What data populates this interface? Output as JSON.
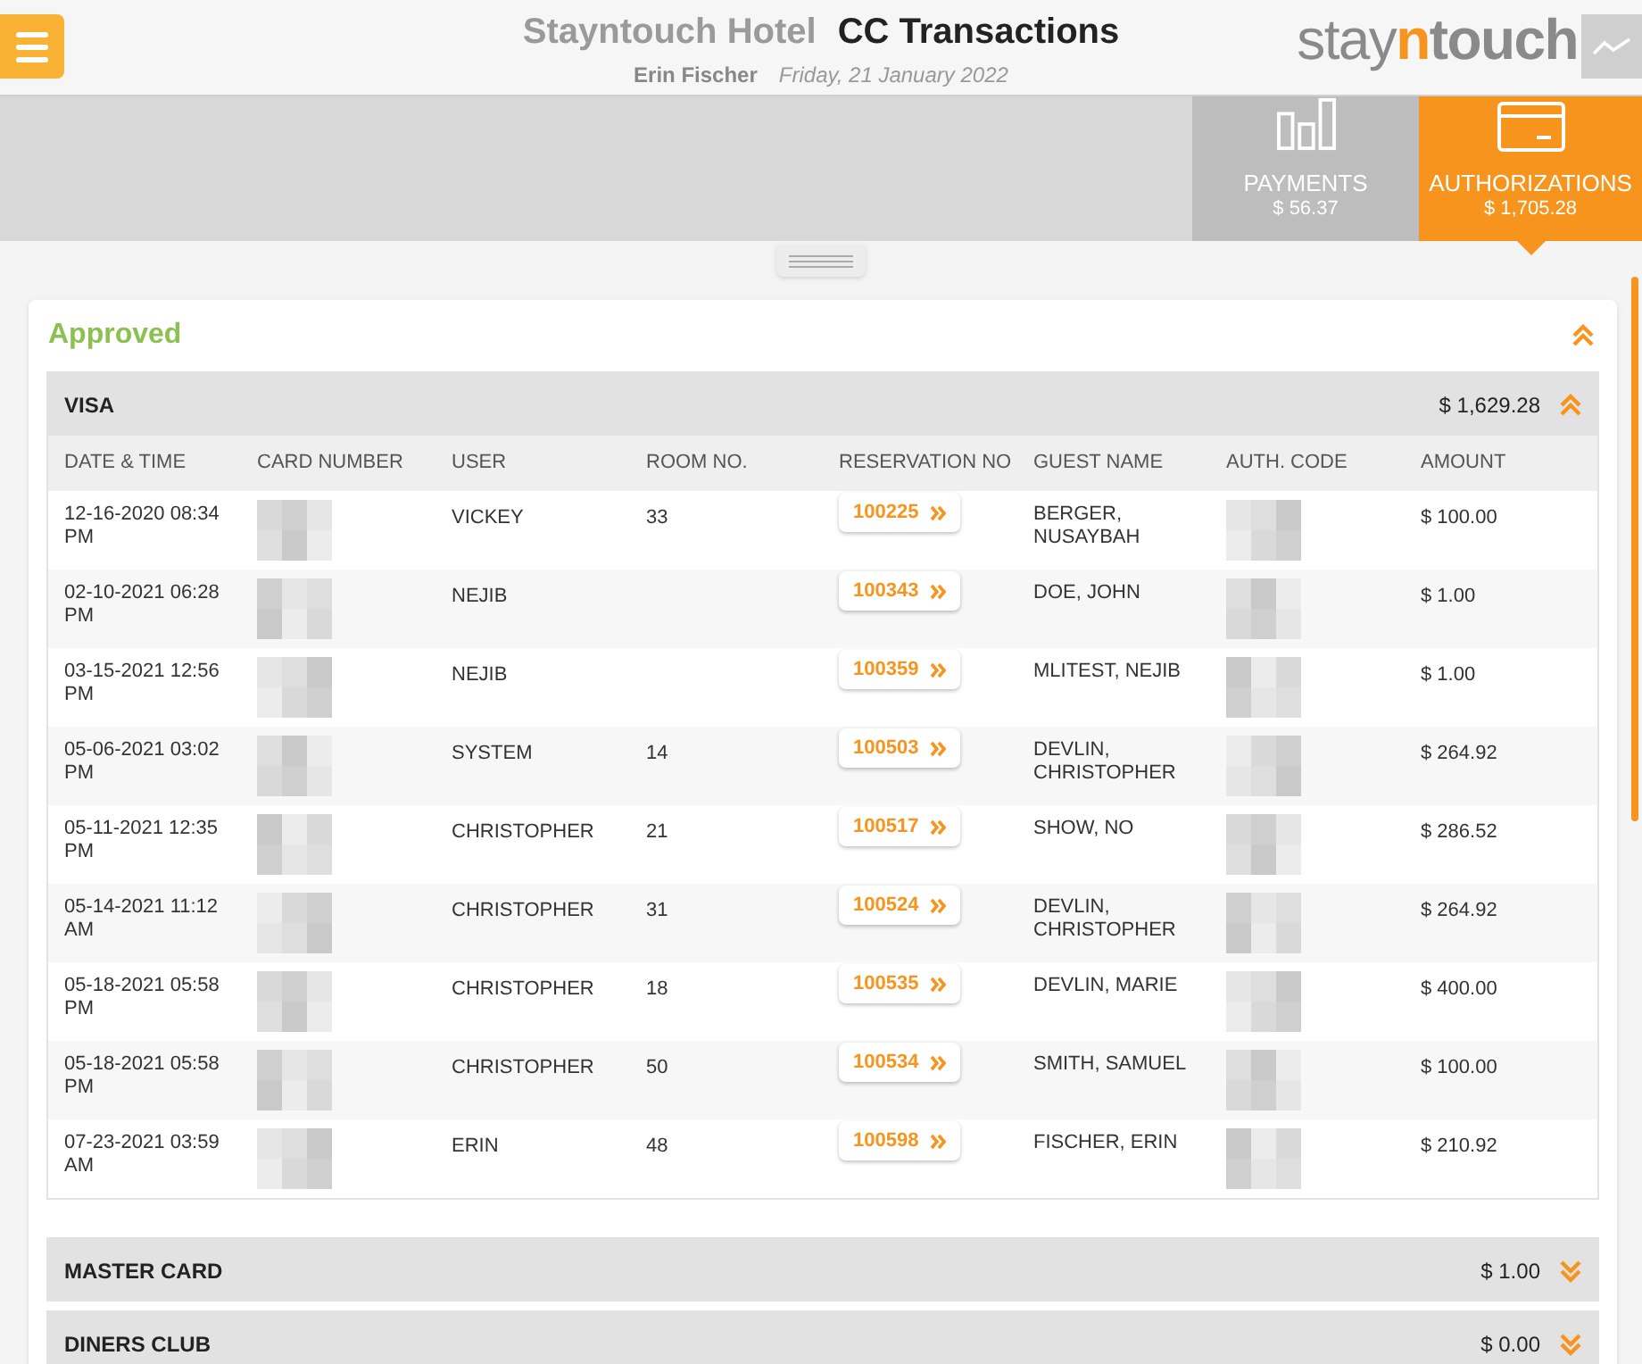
{
  "header": {
    "hotel": "Stayntouch Hotel",
    "title": "CC Transactions",
    "user": "Erin Fischer",
    "date": "Friday, 21 January 2022",
    "logo_start": "stay",
    "logo_mid": "n",
    "logo_end": "touch"
  },
  "tabs": [
    {
      "label": "PAYMENTS",
      "amount": "$ 56.37",
      "kind": "payments",
      "selected": false
    },
    {
      "label": "AUTHORIZATIONS",
      "amount": "$ 1,705.28",
      "kind": "authorizations",
      "selected": true
    }
  ],
  "section": {
    "title": "Approved",
    "expanded": true,
    "groups": [
      {
        "name": "VISA",
        "total": "$ 1,629.28",
        "expanded": true,
        "columns": [
          "DATE & TIME",
          "CARD NUMBER",
          "USER",
          "ROOM NO.",
          "RESERVATION NO",
          "GUEST NAME",
          "AUTH. CODE",
          "AMOUNT"
        ],
        "rows": [
          {
            "datetime": "12-16-2020 08:34 PM",
            "user": "VICKEY",
            "room": "33",
            "reservation": "100225",
            "guest": "BERGER, NUSAYBAH",
            "amount": "$ 100.00"
          },
          {
            "datetime": "02-10-2021 06:28 PM",
            "user": "NEJIB",
            "reservation": "100343",
            "guest": "DOE, JOHN",
            "amount": "$ 1.00"
          },
          {
            "datetime": "03-15-2021 12:56 PM",
            "user": "NEJIB",
            "reservation": "100359",
            "guest": "MLITEST, NEJIB",
            "amount": "$ 1.00"
          },
          {
            "datetime": "05-06-2021 03:02 PM",
            "user": "SYSTEM",
            "room": "14",
            "reservation": "100503",
            "guest": "DEVLIN, CHRISTOPHER",
            "amount": "$ 264.92"
          },
          {
            "datetime": "05-11-2021 12:35 PM",
            "user": "CHRISTOPHER",
            "room": "21",
            "reservation": "100517",
            "guest": "SHOW, NO",
            "amount": "$ 286.52"
          },
          {
            "datetime": "05-14-2021 11:12 AM",
            "user": "CHRISTOPHER",
            "room": "31",
            "reservation": "100524",
            "guest": "DEVLIN, CHRISTOPHER",
            "amount": "$ 264.92"
          },
          {
            "datetime": "05-18-2021 05:58 PM",
            "user": "CHRISTOPHER",
            "room": "18",
            "reservation": "100535",
            "guest": "DEVLIN, MARIE",
            "amount": "$ 400.00"
          },
          {
            "datetime": "05-18-2021 05:58 PM",
            "user": "CHRISTOPHER",
            "room": "50",
            "reservation": "100534",
            "guest": "SMITH, SAMUEL",
            "amount": "$ 100.00"
          },
          {
            "datetime": "07-23-2021 03:59 AM",
            "user": "ERIN",
            "room": "48",
            "reservation": "100598",
            "guest": "FISCHER, ERIN",
            "amount": "$ 210.92"
          }
        ]
      },
      {
        "name": "MASTER CARD",
        "total": "$ 1.00",
        "expanded": false
      },
      {
        "name": "DINERS CLUB",
        "total": "$ 0.00",
        "expanded": false
      }
    ]
  }
}
